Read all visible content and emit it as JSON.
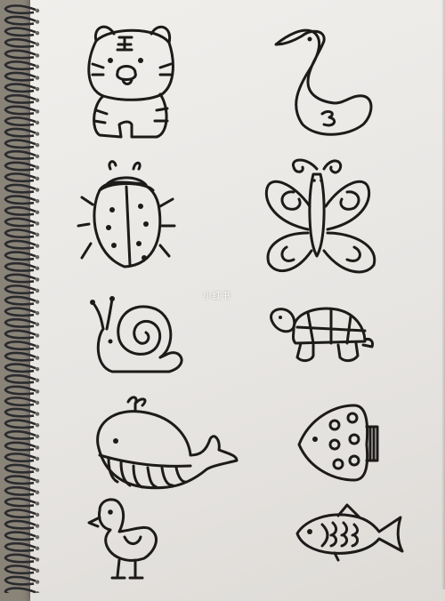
{
  "photo": {
    "subject": "sketchbook-page-of-animal-doodles",
    "drawings": [
      {
        "name": "tiger",
        "icon": "tiger-icon"
      },
      {
        "name": "swan",
        "icon": "swan-icon"
      },
      {
        "name": "ladybug",
        "icon": "ladybug-icon"
      },
      {
        "name": "butterfly",
        "icon": "butterfly-icon"
      },
      {
        "name": "snail",
        "icon": "snail-icon"
      },
      {
        "name": "turtle",
        "icon": "turtle-icon"
      },
      {
        "name": "whale",
        "icon": "whale-icon"
      },
      {
        "name": "round-fish",
        "icon": "fish-icon"
      },
      {
        "name": "chick",
        "icon": "chick-icon"
      },
      {
        "name": "fish",
        "icon": "fish-icon"
      }
    ],
    "colors": {
      "paper": "#ebe9e6",
      "ink": "#1c1b1a",
      "background": "#8a8378"
    }
  },
  "watermark": {
    "text": "小红书"
  }
}
